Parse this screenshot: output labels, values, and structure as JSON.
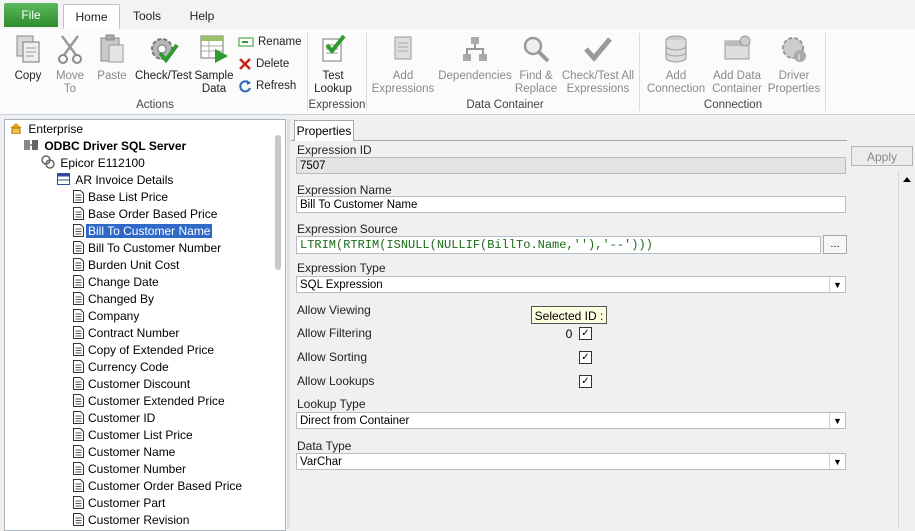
{
  "menu": {
    "file": "File",
    "tabs": [
      "Home",
      "Tools",
      "Help"
    ]
  },
  "ribbon": {
    "actions": {
      "copy": "Copy",
      "move_to_1": "Move",
      "move_to_2": "To",
      "paste": "Paste",
      "check_test": "Check/Test",
      "sample_data_1": "Sample",
      "sample_data_2": "Data",
      "rename": "Rename",
      "delete": "Delete",
      "refresh": "Refresh",
      "group": "Actions"
    },
    "expression": {
      "test_lookup_1": "Test",
      "test_lookup_2": "Lookup",
      "group": "Expression"
    },
    "data_container": {
      "add_expressions_1": "Add",
      "add_expressions_2": "Expressions",
      "dependencies": "Dependencies",
      "find_replace_1": "Find &",
      "find_replace_2": "Replace",
      "check_test_all_1": "Check/Test All",
      "check_test_all_2": "Expressions",
      "group": "Data Container"
    },
    "connection": {
      "add_connection_1": "Add",
      "add_connection_2": "Connection",
      "add_data_container_1": "Add Data",
      "add_data_container_2": "Container",
      "driver_properties_1": "Driver",
      "driver_properties_2": "Properties",
      "group": "Connection"
    }
  },
  "tree": {
    "root": "Enterprise",
    "driver": "ODBC Driver SQL Server",
    "database": "Epicor E112100",
    "container": "AR Invoice Details",
    "items": [
      "Base List Price",
      "Base Order Based Price",
      "Bill To Customer Name",
      "Bill To Customer Number",
      "Burden Unit Cost",
      "Change Date",
      "Changed By",
      "Company",
      "Contract Number",
      "Copy of Extended Price",
      "Currency Code",
      "Customer Discount",
      "Customer Extended Price",
      "Customer ID",
      "Customer List Price",
      "Customer Name",
      "Customer Number",
      "Customer Order Based Price",
      "Customer Part",
      "Customer Revision"
    ],
    "selected_index": 2
  },
  "properties": {
    "tab": "Properties",
    "apply": "Apply",
    "expression_id_label": "Expression ID",
    "expression_id": "7507",
    "expression_name_label": "Expression Name",
    "expression_name": "Bill To Customer Name",
    "expression_source_label": "Expression Source",
    "expression_source": "LTRIM(RTRIM(ISNULL(NULLIF(BillTo.Name,''),'--')))",
    "ellipsis": "...",
    "expression_type_label": "Expression Type",
    "expression_type": "SQL Expression",
    "allow_viewing_label": "Allow Viewing",
    "allow_filtering_label": "Allow Filtering",
    "allow_sorting_label": "Allow Sorting",
    "allow_lookups_label": "Allow Lookups",
    "check": "✓",
    "tooltip": "Selected ID : 0",
    "lookup_type_label": "Lookup Type",
    "lookup_type": "Direct from Container",
    "data_type_label": "Data Type",
    "data_type": "VarChar"
  },
  "colors": {
    "file_tab": "#3a9a3a",
    "selection": "#3068c8",
    "source_text": "#186b18"
  }
}
